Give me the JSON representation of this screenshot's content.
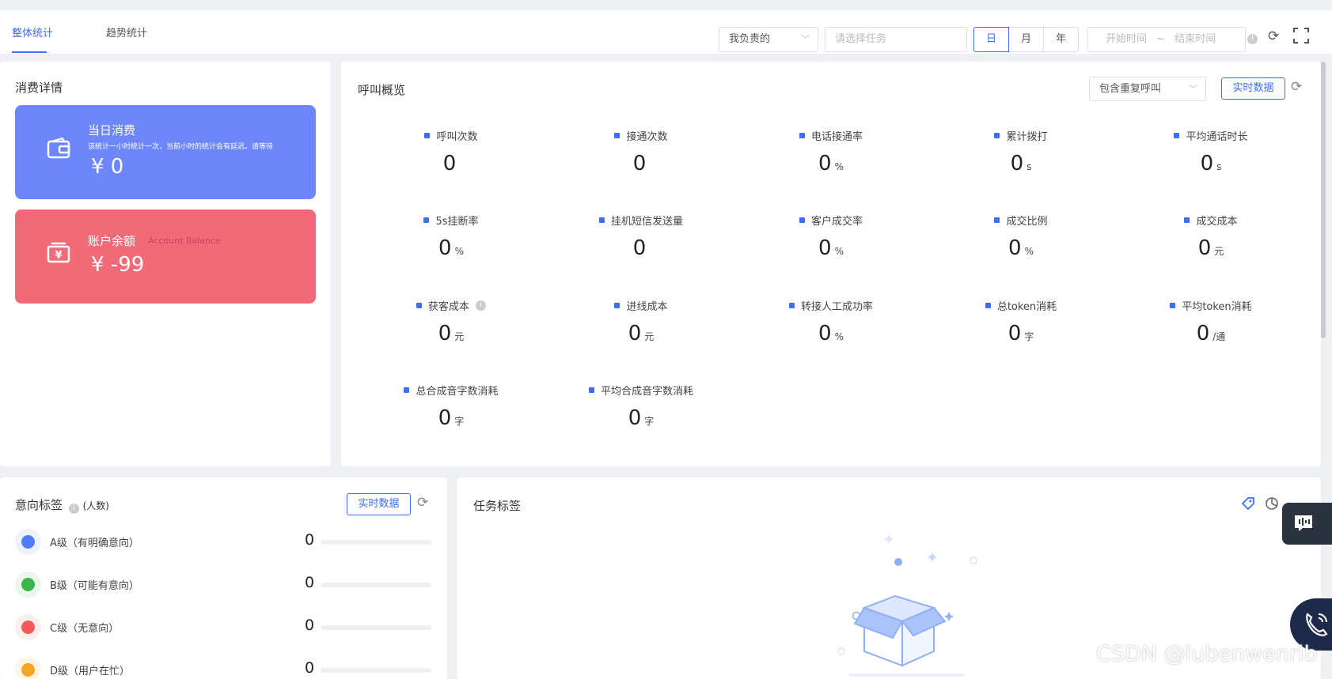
{
  "tabs": [
    "整体统计",
    "趋势统计"
  ],
  "filters": {
    "owner_select": "我负责的",
    "task_placeholder": "请选择任务",
    "periods": [
      "日",
      "月",
      "年"
    ],
    "active_period": "日",
    "date_start": "开始时间",
    "date_sep": "~",
    "date_end": "结束时间"
  },
  "consumption": {
    "title": "消费详情",
    "today": {
      "title": "当日消费",
      "note": "该统计一小时统计一次，当前小时的统计会有延迟。请等待",
      "amount": "¥  0",
      "color": "#6d87fb",
      "icon": "wallet-icon"
    },
    "balance": {
      "title": "账户余额",
      "subtitle": "Account Balance",
      "amount": "¥  -99",
      "color": "#f06a78",
      "icon": "yen-bill-icon"
    }
  },
  "call_overview": {
    "title": "呼叫概览",
    "select": "包含重复呼叫",
    "realtime_btn": "实时数据",
    "metrics": [
      {
        "label": "呼叫次数",
        "value": "0",
        "unit": ""
      },
      {
        "label": "接通次数",
        "value": "0",
        "unit": ""
      },
      {
        "label": "电话接通率",
        "value": "0",
        "unit": "%"
      },
      {
        "label": "累计拨打",
        "value": "0",
        "unit": "s"
      },
      {
        "label": "平均通话时长",
        "value": "0",
        "unit": "s"
      },
      {
        "label": "5s挂断率",
        "value": "0",
        "unit": "%"
      },
      {
        "label": "挂机短信发送量",
        "value": "0",
        "unit": ""
      },
      {
        "label": "客户成交率",
        "value": "0",
        "unit": "%"
      },
      {
        "label": "成交比例",
        "value": "0",
        "unit": "%"
      },
      {
        "label": "成交成本",
        "value": "0",
        "unit": "元"
      },
      {
        "label": "获客成本",
        "value": "0",
        "unit": "元"
      },
      {
        "label": "进线成本",
        "value": "0",
        "unit": "元"
      },
      {
        "label": "转接人工成功率",
        "value": "0",
        "unit": "%"
      },
      {
        "label": "总token消耗",
        "value": "0",
        "unit": "字"
      },
      {
        "label": "平均token消耗",
        "value": "0",
        "unit": "/通"
      },
      {
        "label": "总合成音字数消耗",
        "value": "0",
        "unit": "字"
      },
      {
        "label": "平均合成音字数消耗",
        "value": "0",
        "unit": "字"
      }
    ]
  },
  "intent": {
    "title": "意向标签",
    "suffix": "(人数)",
    "realtime_btn": "实时数据",
    "rows": [
      {
        "name": "A级（有明确意向）",
        "count": "0",
        "color": "#4f7cf7",
        "bg": "#eef2ff"
      },
      {
        "name": "B级（可能有意向）",
        "count": "0",
        "color": "#3bb54a",
        "bg": "#eaf8ec"
      },
      {
        "name": "C级（无意向）",
        "count": "0",
        "color": "#f25a5a",
        "bg": "#fdeeee"
      },
      {
        "name": "D级（用户在忙）",
        "count": "0",
        "color": "#f5a623",
        "bg": "#fff5e6"
      }
    ]
  },
  "task_tags": {
    "title": "任务标签"
  },
  "watermark": "CSDN @lubenwenrib"
}
